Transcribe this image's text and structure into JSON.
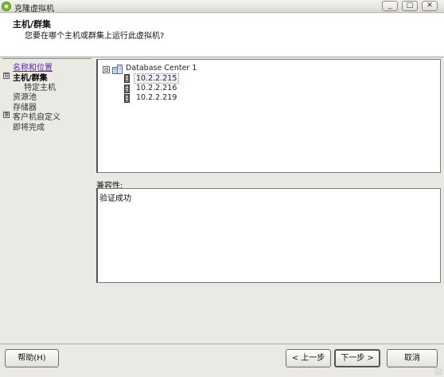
{
  "window": {
    "title": "克隆虚拟机",
    "minimize_glyph": "_",
    "maximize_glyph": "□",
    "close_glyph": "✕"
  },
  "header": {
    "title": "主机/群集",
    "subtitle": "您要在哪个主机或群集上运行此虚拟机?"
  },
  "nav": {
    "items": [
      {
        "label": "名称和位置",
        "state": "visited-link"
      },
      {
        "label": "主机/群集",
        "state": "current",
        "expander": "⊟"
      },
      {
        "label": "特定主机",
        "state": "sub"
      },
      {
        "label": "资源池",
        "state": "pending"
      },
      {
        "label": "存储器",
        "state": "pending"
      },
      {
        "label": "客户机自定义",
        "state": "pending",
        "expander": "⊞"
      },
      {
        "label": "即将完成",
        "state": "pending"
      }
    ]
  },
  "tree": {
    "root": {
      "label": "Database Center 1",
      "expander": "⊟",
      "icon": "datacenter-icon"
    },
    "hosts": [
      {
        "label": "10.2.2.215",
        "selected": true,
        "icon": "host-icon"
      },
      {
        "label": "10.2.2.216",
        "selected": false,
        "icon": "host-icon"
      },
      {
        "label": "10.2.2.219",
        "selected": false,
        "icon": "host-icon"
      }
    ]
  },
  "compatibility": {
    "label": "兼容性:",
    "result": "验证成功"
  },
  "footer": {
    "help_label": "帮助(H)",
    "back_label": "< 上一步",
    "next_label": "下一步 >",
    "cancel_label": "取消"
  },
  "colors": {
    "link_visited": "#5a2aa8",
    "app_icon": "#7cbf3a",
    "window_bg": "#ebe9e3"
  }
}
